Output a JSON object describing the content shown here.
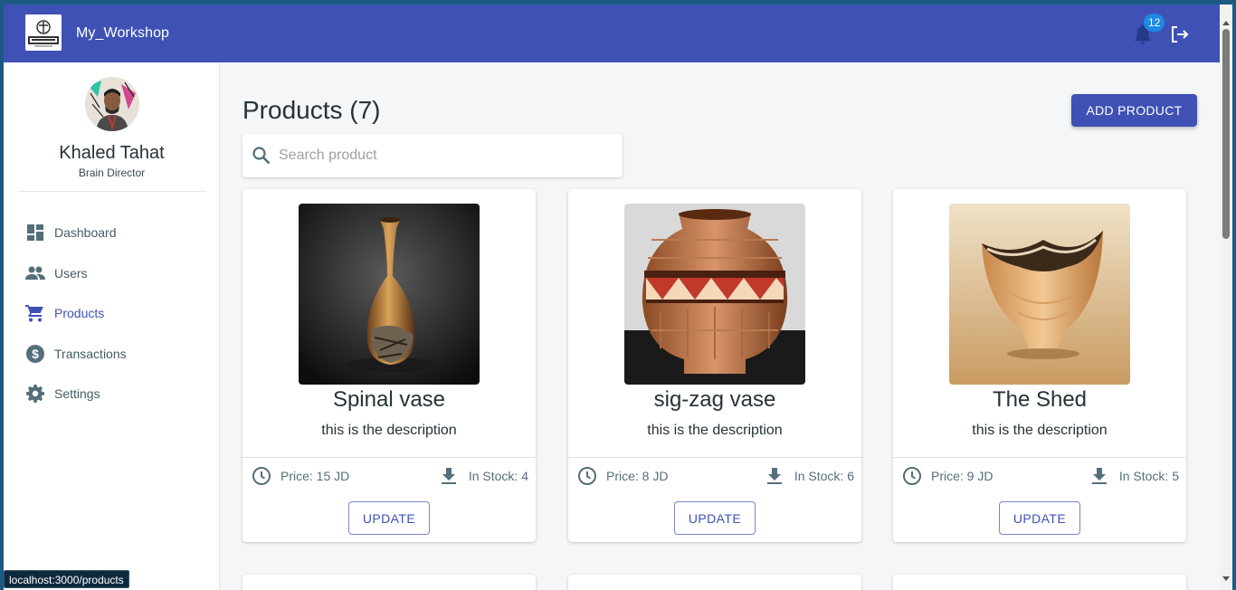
{
  "app": {
    "title": "My_Workshop",
    "logo_icon": "workshop-logo",
    "notification_count": "12"
  },
  "user": {
    "name": "Khaled Tahat",
    "role": "Brain Director"
  },
  "nav": [
    {
      "label": "Dashboard",
      "icon": "dashboard-icon",
      "active": false
    },
    {
      "label": "Users",
      "icon": "users-icon",
      "active": false
    },
    {
      "label": "Products",
      "icon": "cart-icon",
      "active": true
    },
    {
      "label": "Transactions",
      "icon": "dollar-icon",
      "active": false
    },
    {
      "label": "Settings",
      "icon": "gear-icon",
      "active": false
    }
  ],
  "main": {
    "title": "Products (7)",
    "add_button": "ADD PRODUCT",
    "search_placeholder": "Search product"
  },
  "products": [
    {
      "name": "Spinal vase",
      "description": "this is the description",
      "price": "Price: 15 JD",
      "stock": "In Stock: 4",
      "update": "UPDATE"
    },
    {
      "name": "sig-zag vase",
      "description": "this is the description",
      "price": "Price: 8 JD",
      "stock": "In Stock: 6",
      "update": "UPDATE"
    },
    {
      "name": "The Shed",
      "description": "this is the description",
      "price": "Price: 9 JD",
      "stock": "In Stock: 5",
      "update": "UPDATE"
    }
  ],
  "status_url": "localhost:3000/products",
  "colors": {
    "primary": "#3f51b5",
    "badge": "#1e88e5",
    "background": "#f4f6f8"
  }
}
